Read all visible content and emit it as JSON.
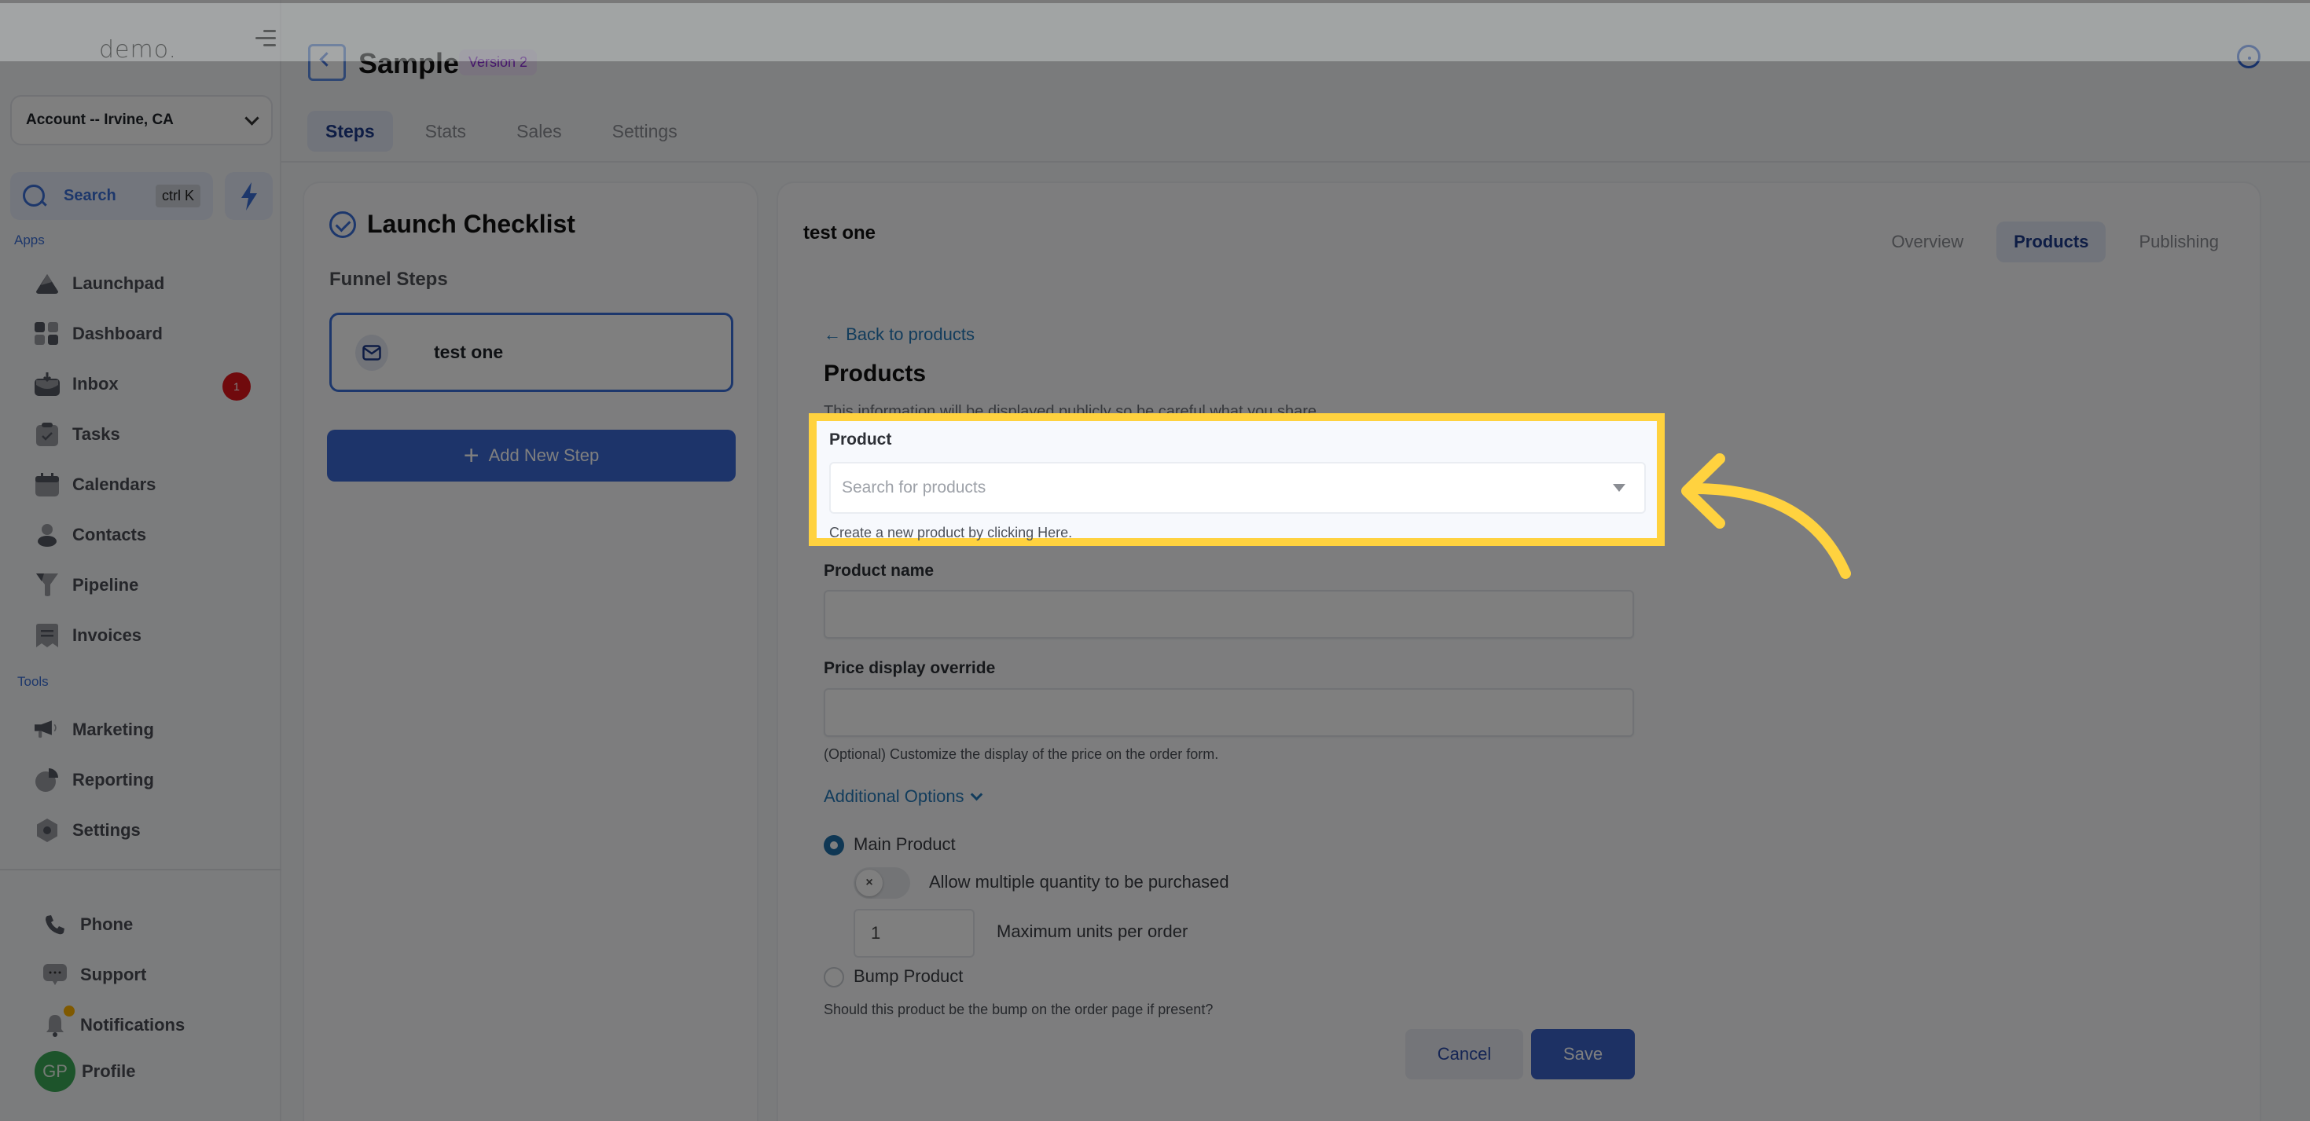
{
  "sidebar": {
    "logo": "demo.",
    "account": "Account -- Irvine, CA",
    "search": {
      "label": "Search",
      "shortcut": "ctrl K"
    },
    "apps_label": "Apps",
    "tools_label": "Tools",
    "apps": [
      {
        "label": "Launchpad",
        "icon": "rocket-icon"
      },
      {
        "label": "Dashboard",
        "icon": "grid-icon"
      },
      {
        "label": "Inbox",
        "icon": "inbox-icon",
        "badge": "1"
      },
      {
        "label": "Tasks",
        "icon": "clipboard-check-icon"
      },
      {
        "label": "Calendars",
        "icon": "calendar-icon"
      },
      {
        "label": "Contacts",
        "icon": "person-icon"
      },
      {
        "label": "Pipeline",
        "icon": "funnel-icon"
      },
      {
        "label": "Invoices",
        "icon": "receipt-icon"
      }
    ],
    "tools": [
      {
        "label": "Marketing",
        "icon": "megaphone-icon"
      },
      {
        "label": "Reporting",
        "icon": "pie-chart-icon"
      },
      {
        "label": "Settings",
        "icon": "gear-icon"
      }
    ],
    "bottom": [
      {
        "label": "Phone",
        "icon": "phone-icon"
      },
      {
        "label": "Support",
        "icon": "chat-bubble-icon"
      },
      {
        "label": "Notifications",
        "icon": "bell-icon"
      },
      {
        "label": "Profile",
        "icon": "avatar",
        "initials": "GP"
      }
    ]
  },
  "header": {
    "title": "Sample",
    "version": "Version 2",
    "tabs": [
      "Steps",
      "Stats",
      "Sales",
      "Settings"
    ],
    "active_tab": "Steps"
  },
  "left_panel": {
    "title": "Launch Checklist",
    "funnel_steps_label": "Funnel Steps",
    "steps": [
      {
        "name": "test one",
        "icon": "mail-icon"
      }
    ],
    "add_step_label": "Add New Step"
  },
  "main_panel": {
    "step_name": "test one",
    "tabs": [
      "Overview",
      "Products",
      "Publishing"
    ],
    "active_tab": "Products",
    "back_link": "Back to products",
    "heading": "Products",
    "info": "This information will be displayed publicly so be careful what you share.",
    "product": {
      "label": "Product",
      "placeholder": "Search for products",
      "hint": "Create a new product by clicking Here."
    },
    "product_name": {
      "label": "Product name",
      "value": ""
    },
    "price_override": {
      "label": "Price display override",
      "value": "",
      "hint": "(Optional) Customize the display of the price on the order form."
    },
    "additional_options_label": "Additional Options",
    "main_product": {
      "label": "Main Product",
      "selected": true,
      "allow_multiple_label": "Allow multiple quantity to be purchased",
      "allow_multiple": false,
      "max_units_value": "1",
      "max_units_label": "Maximum units per order"
    },
    "bump_product": {
      "label": "Bump Product",
      "selected": false,
      "hint": "Should this product be the bump on the order page if present?"
    },
    "cancel_label": "Cancel",
    "save_label": "Save"
  },
  "highlight": {
    "color": "#ffd23f",
    "target": "Product"
  }
}
